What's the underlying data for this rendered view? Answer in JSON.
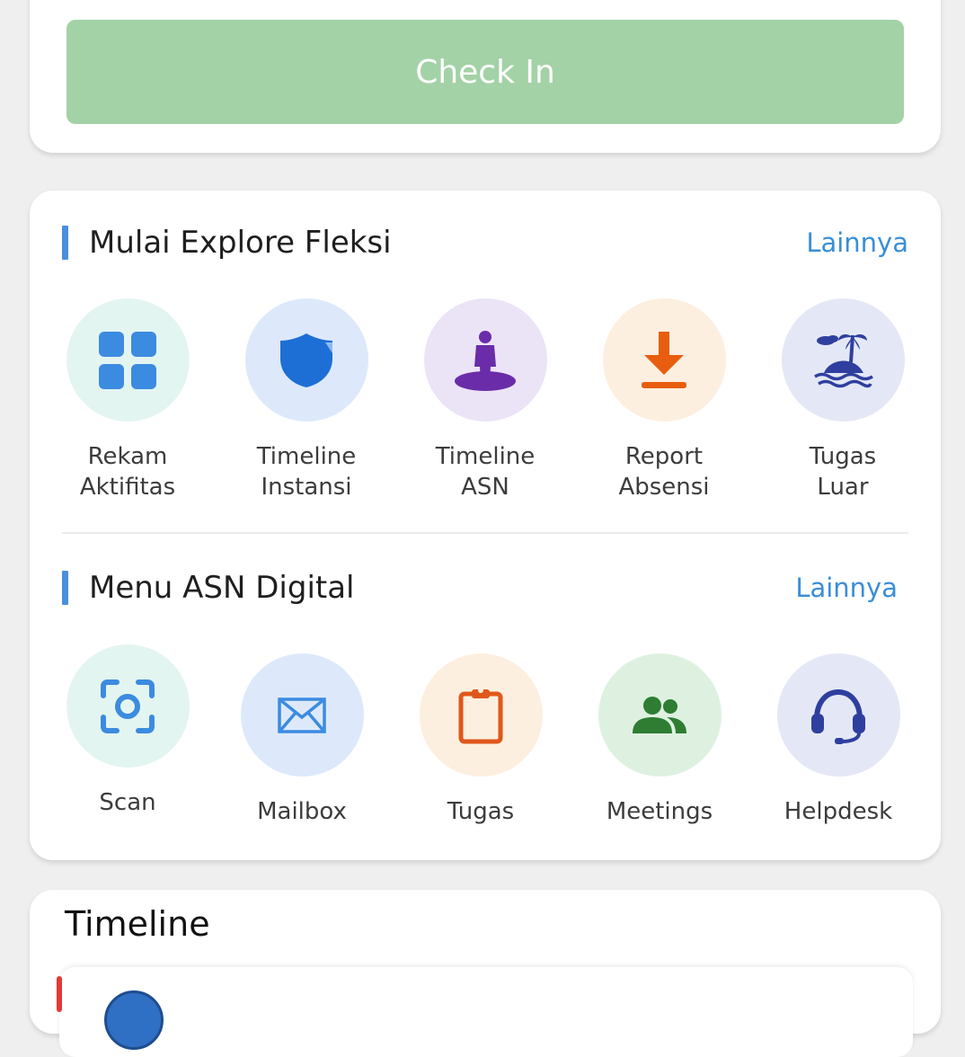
{
  "checkin": {
    "button_label": "Check In",
    "color": "#a3d2a6"
  },
  "explore": {
    "title": "Mulai Explore Fleksi",
    "more_label": "Lainnya",
    "items": [
      {
        "label": "Rekam\nAktifitas",
        "icon": "grid-icon",
        "bg": "#e3f5f1",
        "fg": "#3b8be0"
      },
      {
        "label": "Timeline\nInstansi",
        "icon": "shield-icon",
        "bg": "#dde9fb",
        "fg": "#1d6fd6"
      },
      {
        "label": "Timeline\nASN",
        "icon": "person-on-disc-icon",
        "bg": "#ebe3f6",
        "fg": "#6a2ca8"
      },
      {
        "label": "Report\nAbsensi",
        "icon": "download-icon",
        "bg": "#fdefdf",
        "fg": "#e85d0e"
      },
      {
        "label": "Tugas\nLuar",
        "icon": "island-icon",
        "bg": "#e4e8f6",
        "fg": "#2f3f9f"
      }
    ]
  },
  "digital": {
    "title": "Menu ASN Digital",
    "more_label": "Lainnya",
    "items": [
      {
        "label": "Scan",
        "icon": "scan-icon",
        "bg": "#e3f5f1",
        "fg": "#3b8be0"
      },
      {
        "label": "Mailbox",
        "icon": "mail-icon",
        "bg": "#dde9fb",
        "fg": "#3b8be0"
      },
      {
        "label": "Tugas",
        "icon": "clipboard-icon",
        "bg": "#fdefdf",
        "fg": "#e0571b"
      },
      {
        "label": "Meetings",
        "icon": "people-icon",
        "bg": "#def1e1",
        "fg": "#2e7d32"
      },
      {
        "label": "Helpdesk",
        "icon": "headset-icon",
        "bg": "#e4e8f6",
        "fg": "#2f3f9f"
      }
    ]
  },
  "timeline": {
    "title": "Timeline"
  }
}
